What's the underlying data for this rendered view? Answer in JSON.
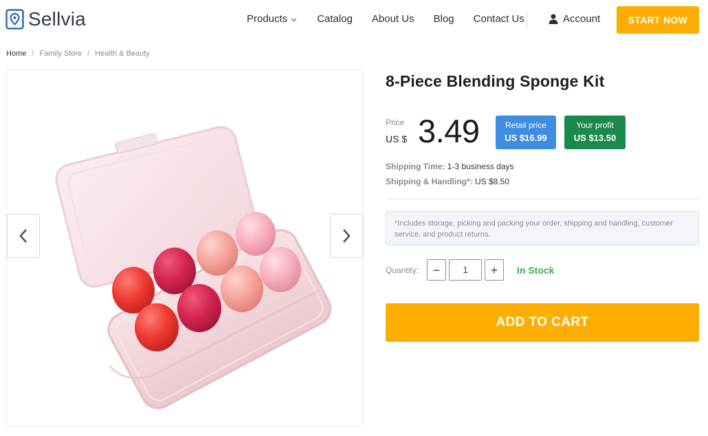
{
  "header": {
    "logo_text": "Sellvia",
    "nav": {
      "products": "Products",
      "catalog": "Catalog",
      "about": "About Us",
      "blog": "Blog",
      "contact": "Contact Us"
    },
    "account_label": "Account",
    "cta_label": "START NOW"
  },
  "breadcrumb": [
    "Home",
    "Family Store",
    "Health & Beauty"
  ],
  "product": {
    "title": "8-Piece Blending Sponge Kit",
    "price_label": "Price",
    "currency": "US $",
    "price": "3.49",
    "retail_label": "Retail price",
    "retail_value": "US $16.99",
    "profit_label": "Your profit",
    "profit_value": "US $13.50",
    "shipping_time_label": "Shipping Time:",
    "shipping_time_value": "1-3 business days",
    "shipping_handling_label": "Shipping & Handling*:",
    "shipping_handling_value": "US $8.50",
    "note": "*Includes storage, picking and packing your order, shipping and handling, customer service, and product returns.",
    "quantity_label": "Quantity:",
    "quantity_value": "1",
    "stock_status": "In Stock",
    "add_to_cart_label": "ADD TO CART"
  },
  "colors": {
    "accent_orange": "#ffad00",
    "retail_blue": "#3e8de0",
    "profit_green": "#1a8a4c",
    "in_stock_green": "#3fae49",
    "logo_blue": "#2b6cb0"
  },
  "icons": {
    "logo": "location-pin-icon",
    "products_dropdown": "chevron-down-icon",
    "account": "user-icon",
    "gallery_prev": "chevron-left-icon",
    "gallery_next": "chevron-right-icon"
  }
}
